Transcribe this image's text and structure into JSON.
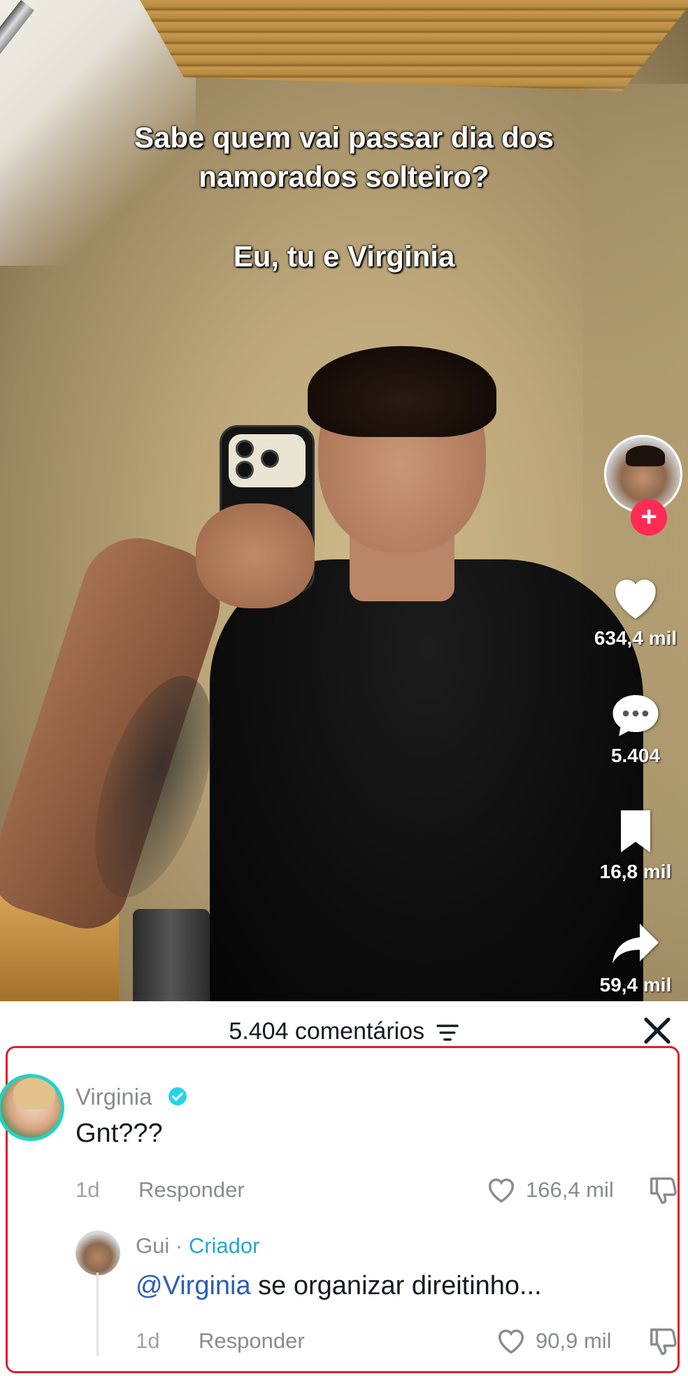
{
  "video": {
    "caption_line1": "Sabe quem vai passar dia dos",
    "caption_line2": "namorados solteiro?",
    "caption_line3": "Eu, tu e Virginia"
  },
  "rail": {
    "likes": "634,4 mil",
    "comments": "5.404",
    "saves": "16,8 mil",
    "shares": "59,4 mil",
    "follow_symbol": "+"
  },
  "comments_sheet": {
    "title": "5.404 comentários",
    "comment": {
      "author": "Virginia",
      "verified": true,
      "text": "Gnt???",
      "time": "1d",
      "reply_label": "Responder",
      "likes": "166,4 mil"
    },
    "reply": {
      "author": "Gui",
      "separator": " · ",
      "author_badge": "Criador",
      "mention": "@Virginia",
      "text": " se organizar direitinho...",
      "time": "1d",
      "reply_label": "Responder",
      "likes": "90,9 mil"
    }
  },
  "colors": {
    "follow": "#fe2c55",
    "verified": "#20d5ec",
    "creator": "#25a9c9",
    "mention": "#2b5db5",
    "highlight": "#d8202f"
  }
}
